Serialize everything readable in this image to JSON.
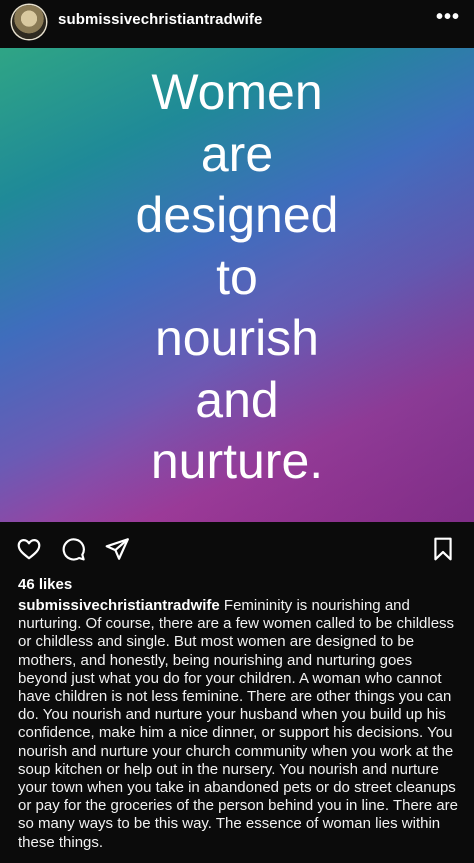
{
  "header": {
    "username": "submissivechristiantradwife",
    "more_label": "•••"
  },
  "post": {
    "image_text": [
      "Women",
      "are",
      "designed",
      "to",
      "nourish",
      "and",
      "nurture."
    ]
  },
  "actions": {
    "icons": [
      "heart-icon",
      "comment-icon",
      "share-icon",
      "bookmark-icon"
    ]
  },
  "likes": "46 likes",
  "caption": {
    "username": "submissivechristiantradwife",
    "text": "Femininity is nourishing and nurturing. Of course, there are a few women called to be childless or childless and single. But most women are designed to be mothers, and honestly, being nourishing and nurturing goes beyond just what you do for your children. A woman who cannot have children is not less feminine. There are other things you can do. You nourish and nurture your husband when you build up his confidence, make him a nice dinner, or support his decisions. You nourish and nurture your church community when you work at the soup kitchen or help out in the nursery. You nourish and nurture your town when you take in abandoned pets or do street cleanups or pay for the groceries of the person behind you in line. There are so many ways to be this way. The essence of woman lies within these things."
  }
}
